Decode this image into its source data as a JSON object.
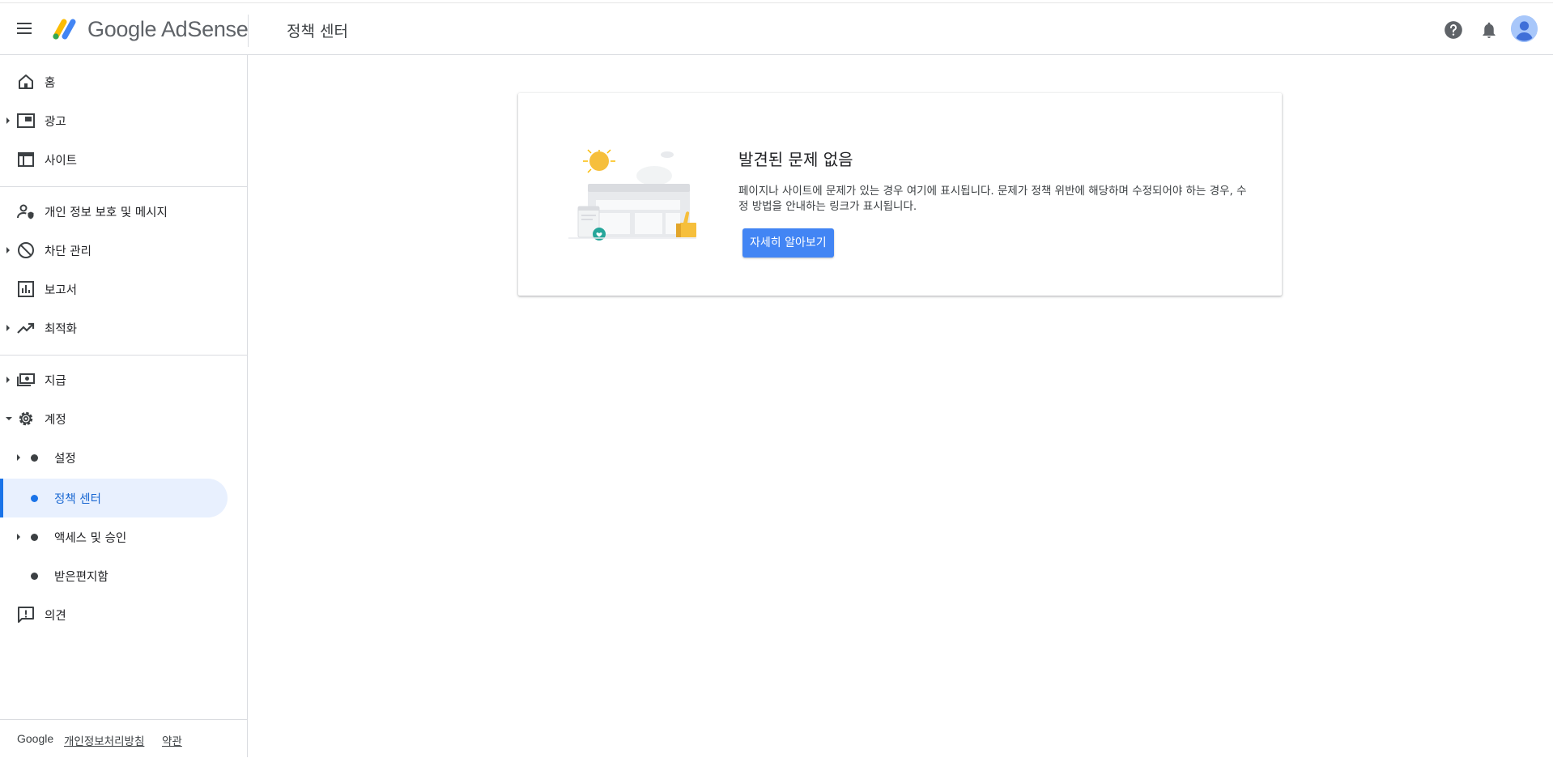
{
  "header": {
    "brand": "Google AdSense",
    "page_title": "정책 센터"
  },
  "sidebar": {
    "items": [
      {
        "label": "홈",
        "icon": "home-icon"
      },
      {
        "label": "광고",
        "icon": "ads-icon"
      },
      {
        "label": "사이트",
        "icon": "sites-icon"
      },
      {
        "label": "개인 정보 보호 및 메시지",
        "icon": "privacy-messaging-icon"
      },
      {
        "label": "차단 관리",
        "icon": "block-icon"
      },
      {
        "label": "보고서",
        "icon": "reports-icon"
      },
      {
        "label": "최적화",
        "icon": "optimization-icon"
      },
      {
        "label": "지급",
        "icon": "payments-icon"
      },
      {
        "label": "계정",
        "icon": "gear-icon"
      },
      {
        "label": "설정",
        "icon": "dot"
      },
      {
        "label": "정책 센터",
        "icon": "dot"
      },
      {
        "label": "액세스 및 승인",
        "icon": "dot"
      },
      {
        "label": "받은편지함",
        "icon": "dot"
      },
      {
        "label": "의견",
        "icon": "feedback-icon"
      }
    ],
    "active_item": "정책 센터"
  },
  "footer": {
    "google": "Google",
    "privacy": "개인정보처리방침",
    "terms": "약관"
  },
  "card": {
    "title": "발견된 문제 없음",
    "body": "페이지나 사이트에 문제가 있는 경우 여기에 표시됩니다. 문제가 정책 위반에 해당하며 수정되어야 하는 경우, 수정 방법을 안내하는 링크가 표시됩니다.",
    "button": "자세히 알아보기"
  },
  "colors": {
    "accent": "#1a73e8",
    "active_bg": "#e8f0fe",
    "button": "#4285f4"
  }
}
